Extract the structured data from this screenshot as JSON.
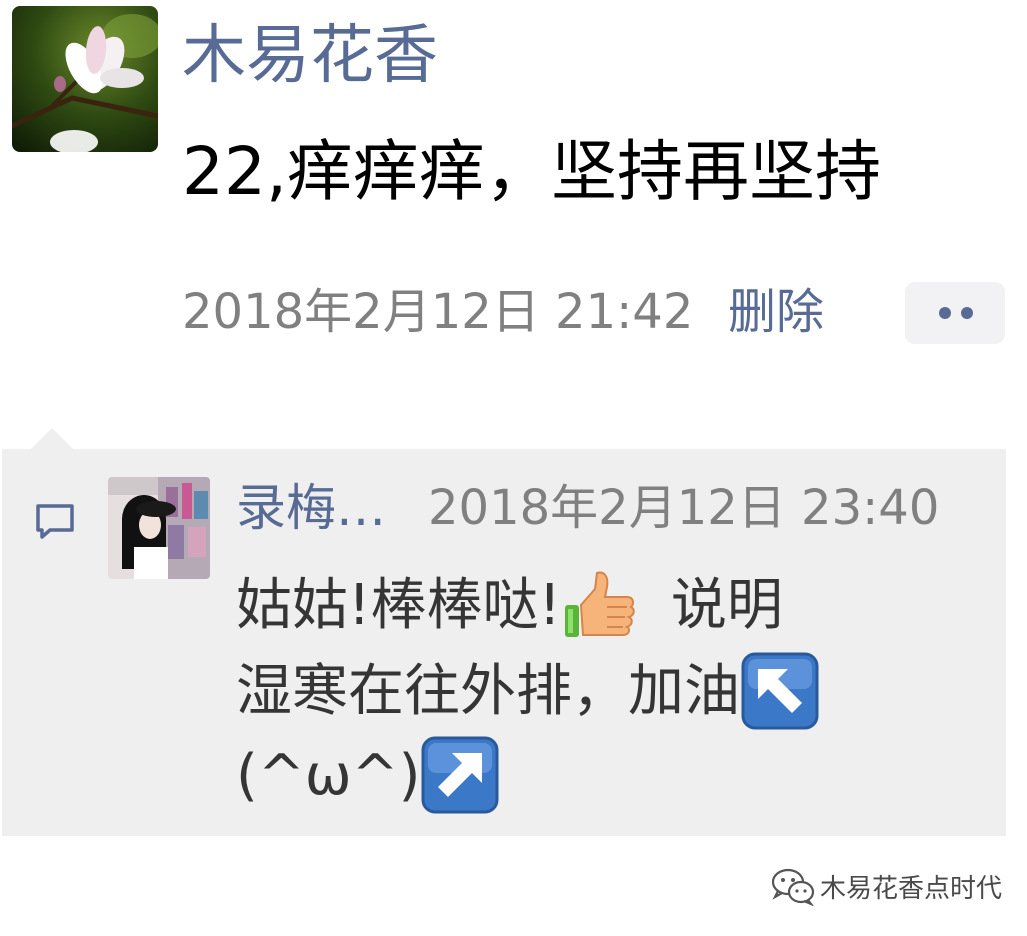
{
  "post": {
    "author": "木易花香",
    "content": "22,痒痒痒，坚持再坚持",
    "timestamp": "2018年2月12日 21:42",
    "delete_label": "删除",
    "more_icon": "more-dots-icon"
  },
  "comment": {
    "icon": "comment-bubble-icon",
    "author": "录梅…",
    "timestamp": "2018年2月12日 23:40",
    "line1_text": "姑姑!棒棒哒!",
    "line1_emoji": "thumbs-up-emoji",
    "line1_tail": "说明",
    "line2_text": "湿寒在往外排，加油",
    "line2_emoji": "arrow-up-left-emoji",
    "line3_text": "(^ω^)",
    "line3_emoji": "arrow-up-right-emoji"
  },
  "watermark": {
    "icon": "wechat-icon",
    "text": "木易花香点时代"
  },
  "colors": {
    "name_link": "#576b95",
    "meta_gray": "#808080",
    "comment_bg": "#efeff0"
  }
}
